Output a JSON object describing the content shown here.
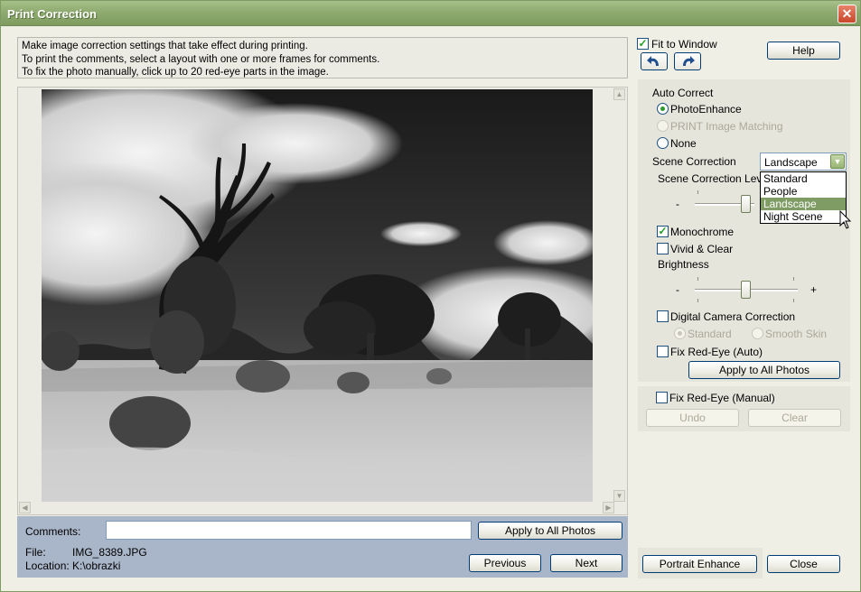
{
  "window": {
    "title": "Print Correction",
    "close_glyph": "✕"
  },
  "info": {
    "lines": [
      "Make image correction settings that take effect during printing.",
      "To print the comments, select a layout with one or more frames for comments.",
      "To fix the photo manually, click up to 20 red-eye parts in the image."
    ]
  },
  "bottom": {
    "comments_label": "Comments:",
    "comments_value": "",
    "apply_all_label": "Apply to All Photos",
    "file_label": "File:",
    "file_value": "IMG_8389.JPG",
    "location_label": "Location:",
    "location_value": "K:\\obrazki",
    "previous_label": "Previous",
    "next_label": "Next"
  },
  "top_right": {
    "fit_to_window_label": "Fit to Window",
    "fit_to_window_checked": true,
    "help_label": "Help",
    "rotate_left_icon": "rotate-left-icon",
    "rotate_right_icon": "rotate-right-icon"
  },
  "auto_correct": {
    "heading": "Auto Correct",
    "options": [
      {
        "label": "PhotoEnhance",
        "selected": true,
        "enabled": true
      },
      {
        "label": "PRINT Image Matching",
        "selected": false,
        "enabled": false
      },
      {
        "label": "None",
        "selected": false,
        "enabled": true
      }
    ],
    "scene_correction_label": "Scene Correction",
    "scene_correction_value": "Landscape",
    "scene_options": [
      "Standard",
      "People",
      "Landscape",
      "Night Scene"
    ],
    "scene_highlighted": "Landscape",
    "scene_level_label": "Scene Correction Leve",
    "scene_level_minus": "-",
    "scene_level_value": 0.5,
    "monochrome_label": "Monochrome",
    "monochrome_checked": true,
    "vivid_label": "Vivid & Clear",
    "vivid_checked": false,
    "brightness_label": "Brightness",
    "brightness_minus": "-",
    "brightness_plus": "+",
    "brightness_value": 0.5,
    "digital_camera_label": "Digital Camera Correction",
    "digital_camera_checked": false,
    "dc_standard_label": "Standard",
    "dc_smooth_skin_label": "Smooth Skin",
    "fix_redeye_auto_label": "Fix Red-Eye (Auto)",
    "fix_redeye_auto_checked": false,
    "apply_all_label": "Apply to All Photos"
  },
  "manual": {
    "fix_redeye_manual_label": "Fix Red-Eye (Manual)",
    "fix_redeye_manual_checked": false,
    "undo_label": "Undo",
    "clear_label": "Clear"
  },
  "footer": {
    "portrait_enhance_label": "Portrait Enhance",
    "close_label": "Close"
  },
  "colors": {
    "titlebar": "#8fab70",
    "panel_blue": "#a9b5c8",
    "highlight": "#7e9c63"
  }
}
